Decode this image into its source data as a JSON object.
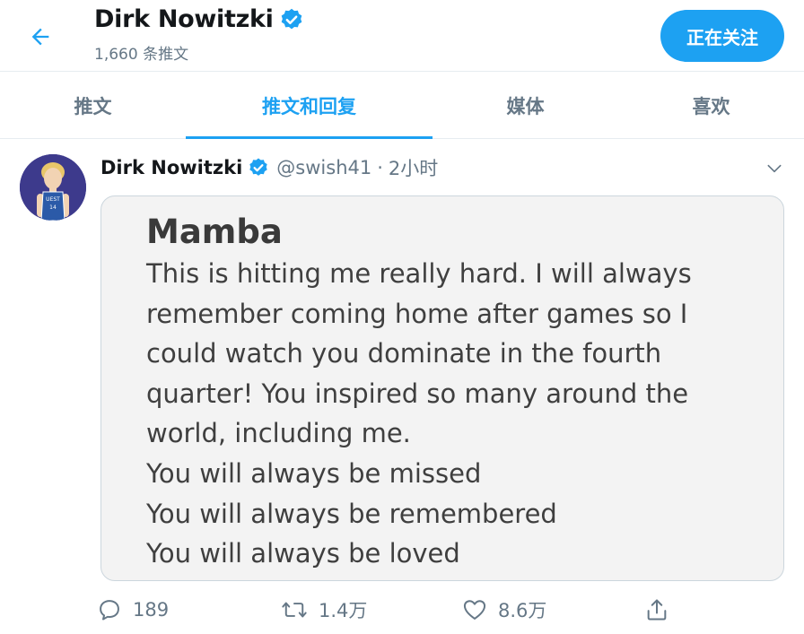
{
  "header": {
    "name": "Dirk Nowitzki",
    "tweet_count": "1,660 条推文",
    "follow_label": "正在关注"
  },
  "tabs": [
    {
      "label": "推文",
      "active": false
    },
    {
      "label": "推文和回复",
      "active": true
    },
    {
      "label": "媒体",
      "active": false
    },
    {
      "label": "喜欢",
      "active": false
    }
  ],
  "tweet": {
    "name": "Dirk Nowitzki",
    "handle": "@swish41",
    "separator": "·",
    "time": "2小时",
    "note": {
      "title": "Mamba",
      "lines": [
        "This is hitting me really hard. I will always",
        "remember coming home after games so I",
        "could watch you dominate in the fourth",
        "quarter! You inspired so many around the",
        "world, including me.",
        "You will always be missed",
        "You will always be remembered",
        "You will always be loved"
      ]
    },
    "actions": {
      "replies": "189",
      "retweets": "1.4万",
      "likes": "8.6万"
    }
  },
  "colors": {
    "accent": "#1da1f2",
    "secondary_text": "#657786",
    "border": "#e6ecf0",
    "avatar_bg": "#3d3a8c"
  },
  "icons": {
    "back": "arrow-left-icon",
    "verified": "verified-badge-icon",
    "caret": "chevron-down-icon",
    "reply": "reply-icon",
    "retweet": "retweet-icon",
    "like": "heart-icon",
    "share": "share-icon"
  }
}
